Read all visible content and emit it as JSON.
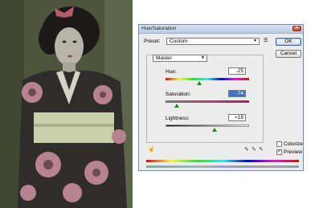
{
  "dialog": {
    "title": "Hue/Saturation",
    "preset_label": "Preset:",
    "preset_value": "Custom",
    "ok_label": "OK",
    "cancel_label": "Cancel",
    "channel_value": "Master",
    "hue": {
      "label": "Hue:",
      "value": "-25",
      "level": 0.4
    },
    "saturation": {
      "label": "Saturation:",
      "value": "-74",
      "level": 0.13
    },
    "lightness": {
      "label": "Lightness:",
      "value": "+18",
      "level": 0.59
    },
    "colorize_label": "Colorize",
    "colorize_checked": false,
    "preview_label": "Preview",
    "preview_checked": true
  },
  "icons": {
    "close": "close-icon",
    "preset_menu": "preset-options-icon",
    "hand": "hand-adjust-icon",
    "eyedropper": "eyedropper-icon",
    "eyedropper_plus": "eyedropper-plus-icon",
    "eyedropper_minus": "eyedropper-minus-icon",
    "dropdown": "chevron-down-icon"
  },
  "colors": {
    "title_bar": "#c9dbef",
    "thumb": "#1c8a22",
    "selection": "#3f74c2"
  }
}
